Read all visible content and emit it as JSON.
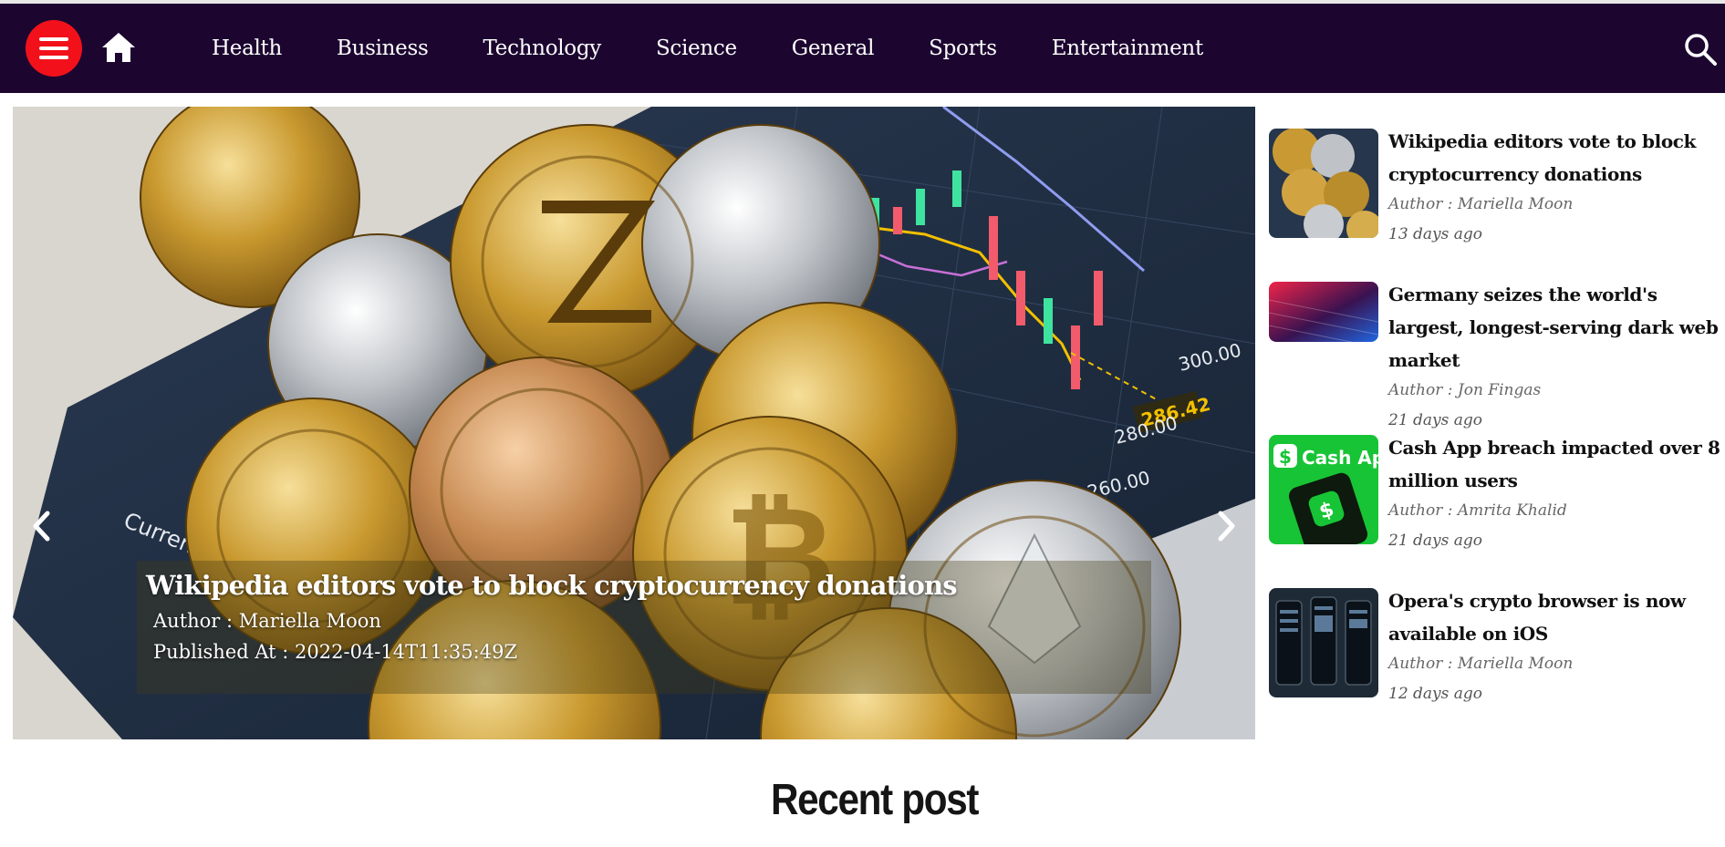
{
  "nav": {
    "menu_icon": "hamburger-icon",
    "home_icon": "home-icon",
    "search_icon": "search-icon",
    "links": [
      "Health",
      "Business",
      "Technology",
      "Science",
      "General",
      "Sports",
      "Entertainment"
    ]
  },
  "colors": {
    "navbar_bg": "#1c0630",
    "menu_button": "#f2111b",
    "caption_overlay": "rgba(70,60,20,0.35)"
  },
  "carousel": {
    "prev_icon": "chevron-left-icon",
    "next_icon": "chevron-right-icon",
    "title": "Wikipedia editors vote to block cryptocurrency donations",
    "author": "Author : Mariella Moon",
    "published": "Published At : 2022-04-14T11:35:49Z"
  },
  "side_posts": [
    {
      "title": "Wikipedia editors vote to block cryptocurrency donations",
      "author": "Author : Mariella Moon",
      "time": "13 days ago"
    },
    {
      "title": "Germany seizes the world's largest, longest-serving dark web market",
      "author": "Author : Jon Fingas",
      "time": "21 days ago"
    },
    {
      "title": "Cash App breach impacted over 8 million users",
      "author": "Author : Amrita Khalid",
      "time": "21 days ago"
    },
    {
      "title": "Opera's crypto browser is now available on iOS",
      "author": "Author : Mariella Moon",
      "time": "12 days ago"
    }
  ],
  "thumb_text": {
    "cash_app": "Cash App"
  },
  "recent": {
    "title": "Recent post"
  }
}
